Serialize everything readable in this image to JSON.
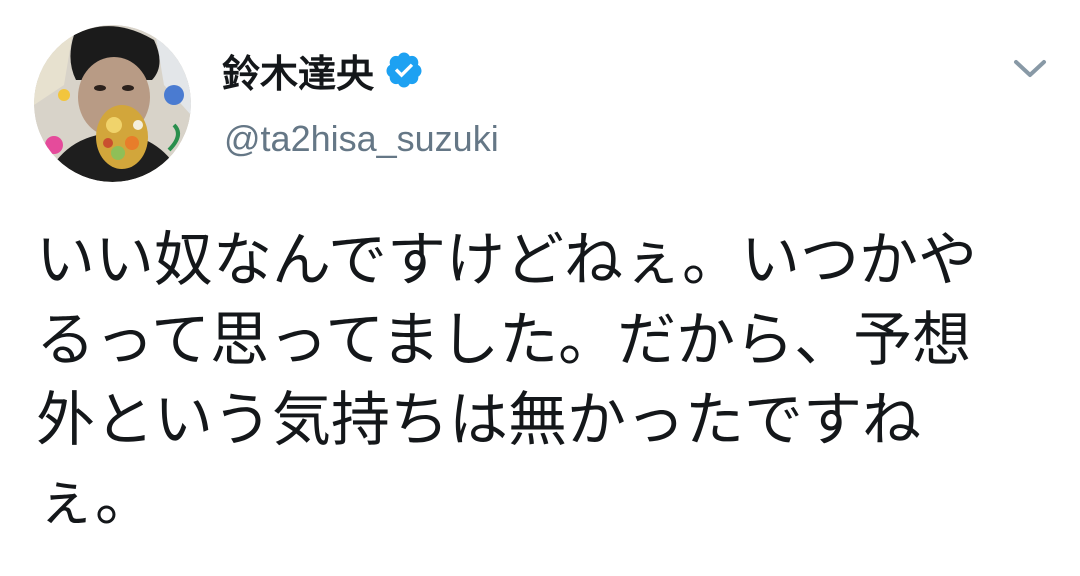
{
  "tweet": {
    "author": {
      "display_name": "鈴木達央",
      "handle": "@ta2hisa_suzuki",
      "verified": true
    },
    "text_lines": [
      "いい奴なんですけどねぇ。いつかや",
      "るって思ってました。だから、予想",
      "外という気持ちは無かったですね",
      "ぇ。"
    ],
    "icons": {
      "verified": "verified-badge-icon",
      "menu": "chevron-down-icon",
      "avatar": "profile-avatar"
    },
    "colors": {
      "verified": "#1da1f2",
      "handle": "#657786",
      "text": "#14171a",
      "caret": "#8899a6"
    }
  }
}
